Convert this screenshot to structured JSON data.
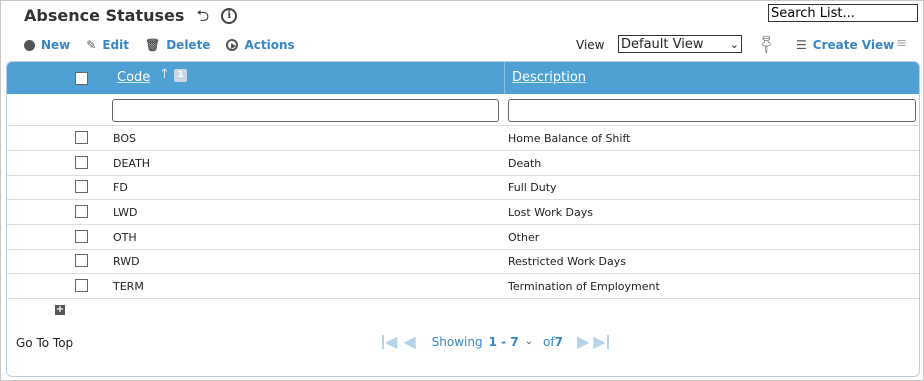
{
  "header": {
    "title": "Absence Statuses",
    "icons": [
      "undo-icon",
      "info-icon"
    ]
  },
  "search": {
    "value": "Search List..."
  },
  "toolbar": {
    "new_label": "New",
    "edit_label": "Edit",
    "delete_label": "Delete",
    "actions_label": "Actions"
  },
  "view": {
    "label": "View",
    "selected": "Default View",
    "create_label": "Create View"
  },
  "grid": {
    "columns": {
      "code": "Code",
      "description": "Description"
    },
    "sort_badge": "1",
    "rows": [
      {
        "code": "BOS",
        "description": "Home Balance of Shift"
      },
      {
        "code": "DEATH",
        "description": "Death"
      },
      {
        "code": "FD",
        "description": "Full Duty"
      },
      {
        "code": "LWD",
        "description": "Lost Work Days"
      },
      {
        "code": "OTH",
        "description": "Other"
      },
      {
        "code": "RWD",
        "description": "Restricted Work Days"
      },
      {
        "code": "TERM",
        "description": "Termination of Employment"
      }
    ]
  },
  "footer": {
    "go_to_top": "Go To Top",
    "showing_label": "Showing",
    "range": "1 - 7",
    "of_label": "of",
    "total": "7"
  },
  "colors": {
    "header_bg": "#4fa0d3",
    "link": "#3a86c4"
  }
}
